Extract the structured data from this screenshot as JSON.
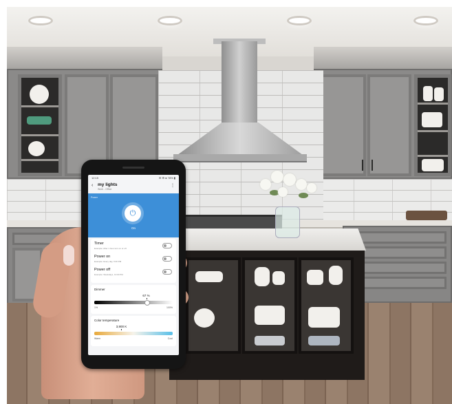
{
  "status_bar": {
    "time": "12:15",
    "icons": "✉ ⚙ ● 78% ▮"
  },
  "app_bar": {
    "back_icon": "back-arrow-icon",
    "title": "my lights",
    "subtitle": "Work - Office",
    "more_icon": "more-vert-icon"
  },
  "power": {
    "label": "Power",
    "state": "On",
    "button_icon": "power-icon",
    "accent_color": "#3d8fd8"
  },
  "rows": [
    {
      "title": "Timer",
      "subtitle": "Example: After 1 hour turn on or off",
      "toggle": false
    },
    {
      "title": "Power on",
      "subtitle": "Example: Every day, 6:00 PM",
      "toggle": false
    },
    {
      "title": "Power off",
      "subtitle": "Example: Weekdays, 10:00 PM",
      "toggle": false
    }
  ],
  "dimmer": {
    "title": "Dimmer",
    "value_label": "67 %",
    "level_percent": 67,
    "min_label": "1%",
    "max_label": "100%"
  },
  "color_temperature": {
    "title": "Color temperature",
    "value_label": "3,900 K",
    "level_fraction": 0.34,
    "min_label": "Warm",
    "max_label": "Cool",
    "warm_color": "#e8a93b",
    "cool_color": "#59bfe8"
  }
}
